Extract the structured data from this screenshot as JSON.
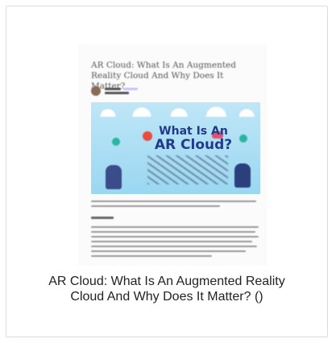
{
  "document": {
    "title": "AR Cloud: What Is An Augmented Reality Cloud And Why Does It Matter?",
    "banner_line1": "What Is An",
    "banner_line2": "AR Cloud?"
  },
  "caption": {
    "line1": "AR Cloud: What Is An Augmented Reality",
    "line2": "Cloud And Why Does It Matter? ()"
  },
  "icons": {
    "avatar": "author-avatar-icon",
    "pin_left": "location-pin-icon",
    "pin_right": "location-pin-icon"
  },
  "colors": {
    "banner_bg": "#9ad7f1",
    "headline": "#213b8a",
    "border": "#dcdcdc"
  }
}
